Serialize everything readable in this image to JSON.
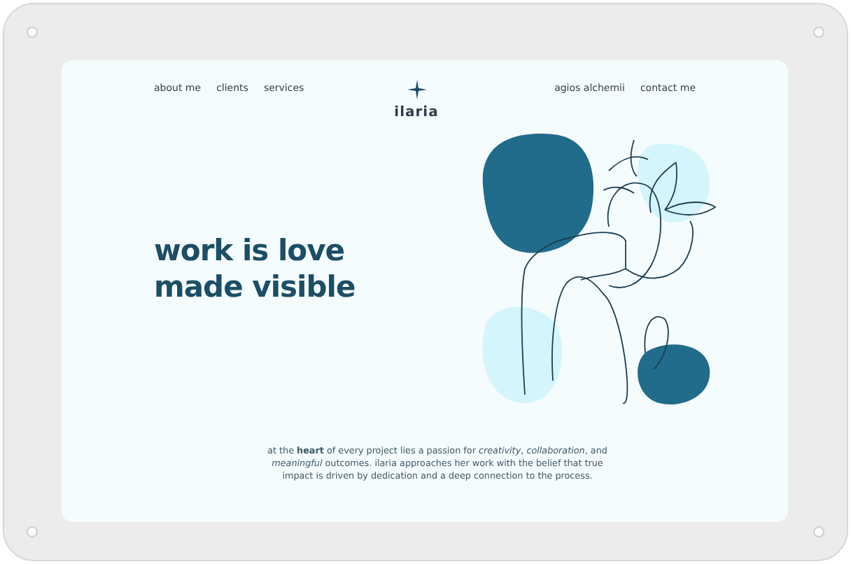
{
  "nav_left": [
    "about me",
    "clients",
    "services"
  ],
  "brand": {
    "name": "ilaria"
  },
  "nav_right": [
    "agios alchemii",
    "contact me"
  ],
  "hero": {
    "heading_lines": [
      "work is love",
      "made visible"
    ]
  },
  "intro": "at the **heart** of every project lies a passion for *creativity*, *collaboration*, and *meaningful* outcomes. ilaria approaches her work with the belief that true impact is driven by dedication and a deep connection to the process."
}
